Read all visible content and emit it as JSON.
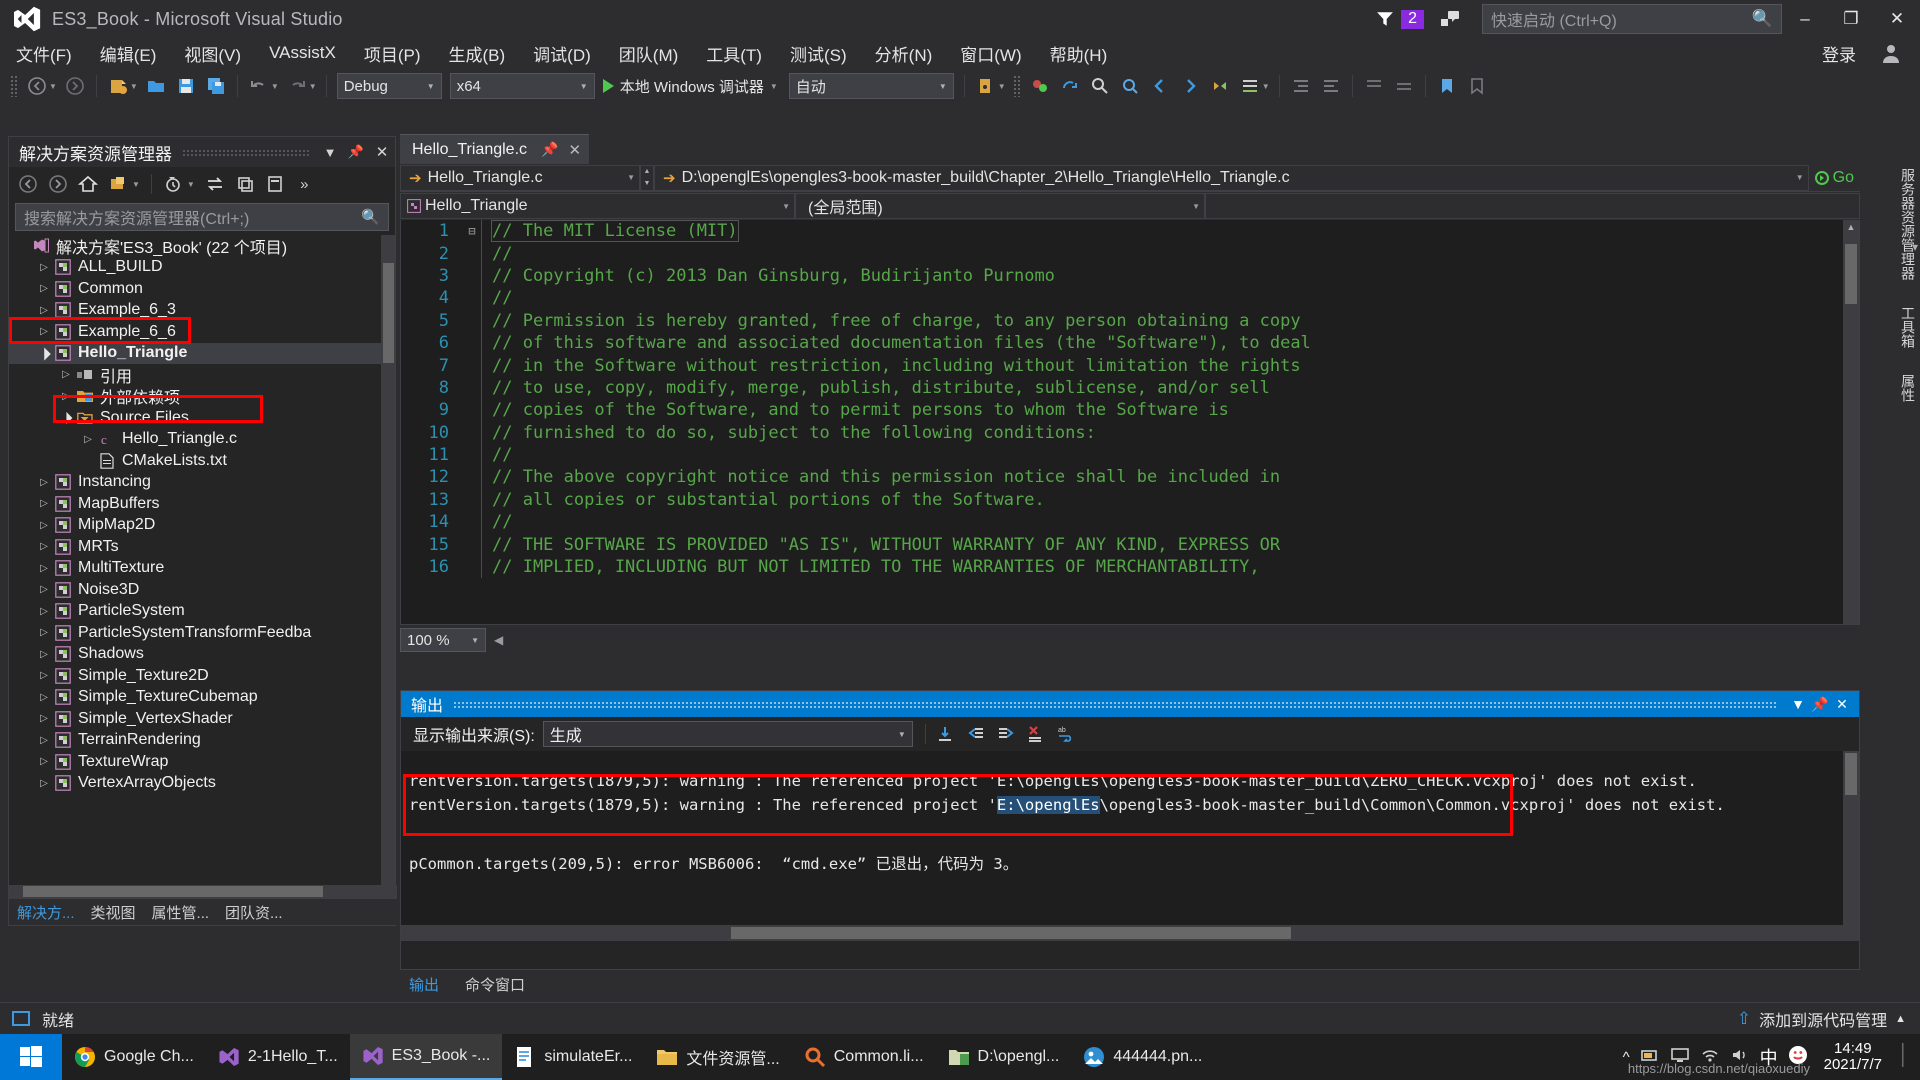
{
  "window": {
    "title": "ES3_Book - Microsoft Visual Studio",
    "logo_icon": "visual-studio-logo",
    "notification_count": "2",
    "feedback_icon": "feedback-icon",
    "minimize": "–",
    "maximize": "❐",
    "close": "✕"
  },
  "quick_launch": {
    "placeholder": "快速启动 (Ctrl+Q)",
    "icon": "search-icon"
  },
  "menu": {
    "items": [
      "文件(F)",
      "编辑(E)",
      "视图(V)",
      "VAssistX",
      "项目(P)",
      "生成(B)",
      "调试(D)",
      "团队(M)",
      "工具(T)",
      "测试(S)",
      "分析(N)",
      "窗口(W)",
      "帮助(H)"
    ],
    "login": "登录",
    "account_icon": "account-icon"
  },
  "toolbar": {
    "configuration": "Debug",
    "platform": "x64",
    "run_label": "本地 Windows 调试器",
    "run_icon": "play-icon",
    "attach_target": "自动",
    "icons": [
      "back-icon",
      "forward-icon",
      "new-project-icon",
      "open-file-icon",
      "save-icon",
      "save-all-icon",
      "undo-icon",
      "redo-icon"
    ]
  },
  "solution_explorer": {
    "title": "解决方案资源管理器",
    "dropdown_icon": "chevron-down-icon",
    "toolbar_icons": [
      "back-icon",
      "forward-icon",
      "home-icon",
      "show-all-files-icon",
      "pending-changes-icon",
      "sync-icon",
      "collapse-all-icon",
      "properties-icon"
    ],
    "search_placeholder": "搜索解决方案资源管理器(Ctrl+;)",
    "search_icon": "search-icon",
    "tree": [
      {
        "label": "解决方案'ES3_Book' (22 个项目)",
        "indent": 0,
        "arrow": "none",
        "icon": "solution-icon",
        "selected": false
      },
      {
        "label": "ALL_BUILD",
        "indent": 1,
        "arrow": "collapsed",
        "icon": "project-icon",
        "selected": false
      },
      {
        "label": "Common",
        "indent": 1,
        "arrow": "collapsed",
        "icon": "project-icon",
        "selected": false
      },
      {
        "label": "Example_6_3",
        "indent": 1,
        "arrow": "collapsed",
        "icon": "project-icon",
        "selected": false
      },
      {
        "label": "Example_6_6",
        "indent": 1,
        "arrow": "collapsed",
        "icon": "project-icon",
        "selected": false
      },
      {
        "label": "Hello_Triangle",
        "indent": 1,
        "arrow": "expanded",
        "icon": "project-icon",
        "selected": true
      },
      {
        "label": "引用",
        "indent": 2,
        "arrow": "collapsed",
        "icon": "references-icon",
        "selected": false
      },
      {
        "label": "外部依赖项",
        "indent": 2,
        "arrow": "collapsed",
        "icon": "external-deps-icon",
        "selected": false
      },
      {
        "label": "Source Files",
        "indent": 2,
        "arrow": "expanded",
        "icon": "filter-folder-icon",
        "selected": false
      },
      {
        "label": "Hello_Triangle.c",
        "indent": 3,
        "arrow": "collapsed",
        "icon": "c-file-icon",
        "selected": false
      },
      {
        "label": "CMakeLists.txt",
        "indent": 3,
        "arrow": "none",
        "icon": "txt-file-icon",
        "selected": false
      },
      {
        "label": "Instancing",
        "indent": 1,
        "arrow": "collapsed",
        "icon": "project-icon",
        "selected": false
      },
      {
        "label": "MapBuffers",
        "indent": 1,
        "arrow": "collapsed",
        "icon": "project-icon",
        "selected": false
      },
      {
        "label": "MipMap2D",
        "indent": 1,
        "arrow": "collapsed",
        "icon": "project-icon",
        "selected": false
      },
      {
        "label": "MRTs",
        "indent": 1,
        "arrow": "collapsed",
        "icon": "project-icon",
        "selected": false
      },
      {
        "label": "MultiTexture",
        "indent": 1,
        "arrow": "collapsed",
        "icon": "project-icon",
        "selected": false
      },
      {
        "label": "Noise3D",
        "indent": 1,
        "arrow": "collapsed",
        "icon": "project-icon",
        "selected": false
      },
      {
        "label": "ParticleSystem",
        "indent": 1,
        "arrow": "collapsed",
        "icon": "project-icon",
        "selected": false
      },
      {
        "label": "ParticleSystemTransformFeedba",
        "indent": 1,
        "arrow": "collapsed",
        "icon": "project-icon",
        "selected": false
      },
      {
        "label": "Shadows",
        "indent": 1,
        "arrow": "collapsed",
        "icon": "project-icon",
        "selected": false
      },
      {
        "label": "Simple_Texture2D",
        "indent": 1,
        "arrow": "collapsed",
        "icon": "project-icon",
        "selected": false
      },
      {
        "label": "Simple_TextureCubemap",
        "indent": 1,
        "arrow": "collapsed",
        "icon": "project-icon",
        "selected": false
      },
      {
        "label": "Simple_VertexShader",
        "indent": 1,
        "arrow": "collapsed",
        "icon": "project-icon",
        "selected": false
      },
      {
        "label": "TerrainRendering",
        "indent": 1,
        "arrow": "collapsed",
        "icon": "project-icon",
        "selected": false
      },
      {
        "label": "TextureWrap",
        "indent": 1,
        "arrow": "collapsed",
        "icon": "project-icon",
        "selected": false
      },
      {
        "label": "VertexArrayObjects",
        "indent": 1,
        "arrow": "collapsed",
        "icon": "project-icon",
        "selected": false
      }
    ],
    "bottom_tabs": [
      {
        "label": "解决方...",
        "active": true
      },
      {
        "label": "类视图",
        "active": false
      },
      {
        "label": "属性管...",
        "active": false
      },
      {
        "label": "团队资...",
        "active": false
      }
    ]
  },
  "editor": {
    "tab_label": "Hello_Triangle.c",
    "tab_pin_icon": "pin-icon",
    "tab_close_icon": "close-icon",
    "nav_file": "Hello_Triangle.c",
    "nav_path": "D:\\openglEs\\opengles3-book-master_build\\Chapter_2\\Hello_Triangle\\Hello_Triangle.c",
    "go_label": "Go",
    "project_selector": "Hello_Triangle",
    "scope_selector": "(全局范围)",
    "zoom": "100 %",
    "lines": [
      {
        "num": "1",
        "text": "// The MIT License (MIT)",
        "fold": "⊟"
      },
      {
        "num": "2",
        "text": "//",
        "fold": ""
      },
      {
        "num": "3",
        "text": "// Copyright (c) 2013 Dan Ginsburg, Budirijanto Purnomo",
        "fold": ""
      },
      {
        "num": "4",
        "text": "//",
        "fold": ""
      },
      {
        "num": "5",
        "text": "// Permission is hereby granted, free of charge, to any person obtaining a copy",
        "fold": ""
      },
      {
        "num": "6",
        "text": "// of this software and associated documentation files (the \"Software\"), to deal",
        "fold": ""
      },
      {
        "num": "7",
        "text": "// in the Software without restriction, including without limitation the rights",
        "fold": ""
      },
      {
        "num": "8",
        "text": "// to use, copy, modify, merge, publish, distribute, sublicense, and/or sell",
        "fold": ""
      },
      {
        "num": "9",
        "text": "// copies of the Software, and to permit persons to whom the Software is",
        "fold": ""
      },
      {
        "num": "10",
        "text": "// furnished to do so, subject to the following conditions:",
        "fold": ""
      },
      {
        "num": "11",
        "text": "//",
        "fold": ""
      },
      {
        "num": "12",
        "text": "// The above copyright notice and this permission notice shall be included in",
        "fold": ""
      },
      {
        "num": "13",
        "text": "// all copies or substantial portions of the Software.",
        "fold": ""
      },
      {
        "num": "14",
        "text": "//",
        "fold": ""
      },
      {
        "num": "15",
        "text": "// THE SOFTWARE IS PROVIDED \"AS IS\", WITHOUT WARRANTY OF ANY KIND, EXPRESS OR",
        "fold": ""
      },
      {
        "num": "16",
        "text": "// IMPLIED, INCLUDING BUT NOT LIMITED TO THE WARRANTIES OF MERCHANTABILITY,",
        "fold": ""
      }
    ]
  },
  "output": {
    "title": "输出",
    "dropdown_icon": "chevron-down-icon",
    "pin_icon": "pin-icon",
    "close_icon": "close-icon",
    "source_label": "显示输出来源(S):",
    "source_value": "生成",
    "toolbar_icons": [
      "clear-all-icon",
      "go-to-previous-icon",
      "go-to-next-icon",
      "cancel-icon",
      "word-wrap-icon"
    ],
    "lines": [
      {
        "pre": "rentVersion.targets(1879,5): warning : The referenced project 'E:\\openglEs\\opengles3-book-master_build\\ZERO_CHECK.vcxproj' does not exist.",
        "highlight": "",
        "post": ""
      },
      {
        "pre": "rentVersion.targets(1879,5): warning : The referenced project '",
        "highlight": "E:\\openglEs",
        "post": "\\opengles3-book-master_build\\Common\\Common.vcxproj' does not exist."
      }
    ],
    "error_line": "pCommon.targets(209,5): error MSB6006:  “cmd.exe” 已退出，代码为 3。",
    "bottom_tabs": [
      {
        "label": "输出",
        "active": true
      },
      {
        "label": "命令窗口",
        "active": false
      }
    ]
  },
  "right_dock": {
    "tabs": [
      "服务器资源管理器",
      "工具箱",
      "属性"
    ]
  },
  "statusbar": {
    "status": "就绪",
    "source_control": "添加到源代码管理",
    "up_icon": "arrow-up-icon",
    "chevron": "▲"
  },
  "taskbar": {
    "start_icon": "windows-icon",
    "tasks": [
      {
        "label": "Google Ch...",
        "icon": "chrome-icon",
        "active": false
      },
      {
        "label": "2-1Hello_T...",
        "icon": "visual-studio-icon",
        "active": false
      },
      {
        "label": "ES3_Book -...",
        "icon": "visual-studio-icon",
        "active": true
      },
      {
        "label": "simulateEr...",
        "icon": "vs-doc-icon",
        "active": false
      },
      {
        "label": "文件资源管...",
        "icon": "folder-icon",
        "active": false
      },
      {
        "label": "Common.li...",
        "icon": "search-file-icon",
        "active": false
      },
      {
        "label": "D:\\opengl...",
        "icon": "folder-green-icon",
        "active": false
      },
      {
        "label": "444444.pn...",
        "icon": "image-icon",
        "active": false
      }
    ],
    "tray_icons": [
      "chevron-up-icon",
      "battery-icon",
      "display-icon",
      "volume-icon",
      "ime-cn",
      "sogou-icon"
    ],
    "ime": "中",
    "clock_time": "14:49",
    "clock_date": "2021/7/7",
    "watermark": "https://blog.csdn.net/qiaoxuediy"
  },
  "colors": {
    "accent": "#007acc",
    "comment_green": "#57a64a",
    "line_number_blue": "#2b91af",
    "highlight_box_red": "#ff0000",
    "selection_blue": "#264f78",
    "badge_purple": "#8a2be2",
    "editor_bg": "#1e1e1e",
    "chrome_bg": "#2d2d30"
  }
}
